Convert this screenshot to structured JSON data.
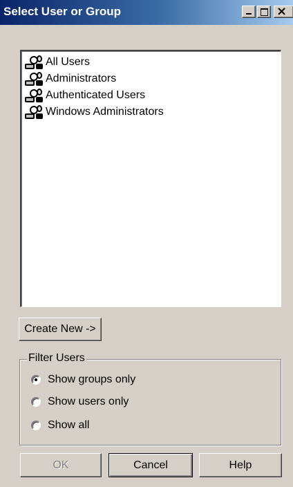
{
  "window": {
    "title": "Select User or Group"
  },
  "list": {
    "items": [
      {
        "label": "All Users",
        "icon": "user-group-icon"
      },
      {
        "label": "Administrators",
        "icon": "user-group-icon"
      },
      {
        "label": "Authenticated Users",
        "icon": "user-group-icon"
      },
      {
        "label": "Windows Administrators",
        "icon": "user-group-icon"
      }
    ]
  },
  "buttons": {
    "create_new": "Create New ->",
    "ok": "OK",
    "cancel": "Cancel",
    "help": "Help"
  },
  "filter": {
    "legend": "Filter Users",
    "options": [
      {
        "label": "Show groups only",
        "selected": true
      },
      {
        "label": "Show users only",
        "selected": false
      },
      {
        "label": "Show all",
        "selected": false
      }
    ]
  },
  "colors": {
    "titlebar_start": "#0a246a",
    "titlebar_end": "#a6caf0",
    "face": "#d4d0c8"
  }
}
